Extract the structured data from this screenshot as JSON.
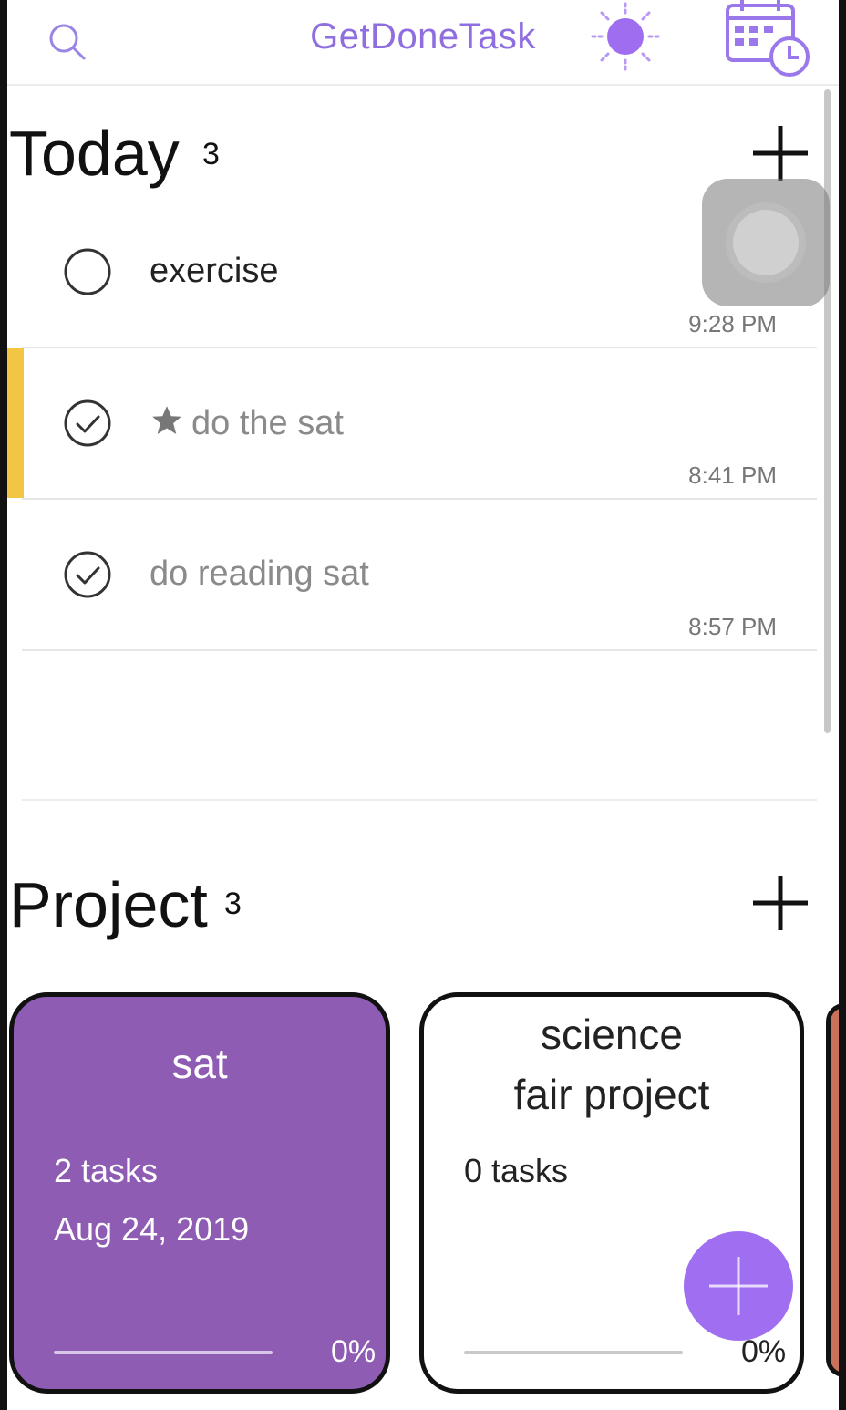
{
  "app": {
    "title": "GetDoneTask"
  },
  "icons": {
    "search": "search-icon",
    "theme": "sun-icon",
    "calendar": "calendar-clock-icon",
    "add": "plus-icon",
    "fab": "plus-icon",
    "check_done": "checkmark-circle-icon",
    "check_open": "empty-circle-icon",
    "star": "star-icon"
  },
  "colors": {
    "accent": "#8f6fe0",
    "priority": "#f2c544",
    "project_sat": "#8e5cb3",
    "fab": "#a06ef0"
  },
  "today": {
    "title": "Today",
    "count": "3",
    "tasks": [
      {
        "label": "exercise",
        "time": "9:28 PM",
        "done": false,
        "starred": false
      },
      {
        "label": "do the sat",
        "time": "8:41 PM",
        "done": true,
        "starred": true
      },
      {
        "label": "do reading sat",
        "time": "8:57 PM",
        "done": true,
        "starred": false
      }
    ]
  },
  "project": {
    "title": "Project",
    "count": "3",
    "cards": [
      {
        "name": "sat",
        "tasks": "2 tasks",
        "date": "Aug 24, 2019",
        "progress": "0%"
      },
      {
        "name_line1": "science",
        "name_line2": "fair project",
        "tasks": "0 tasks",
        "progress": "0%"
      }
    ]
  }
}
